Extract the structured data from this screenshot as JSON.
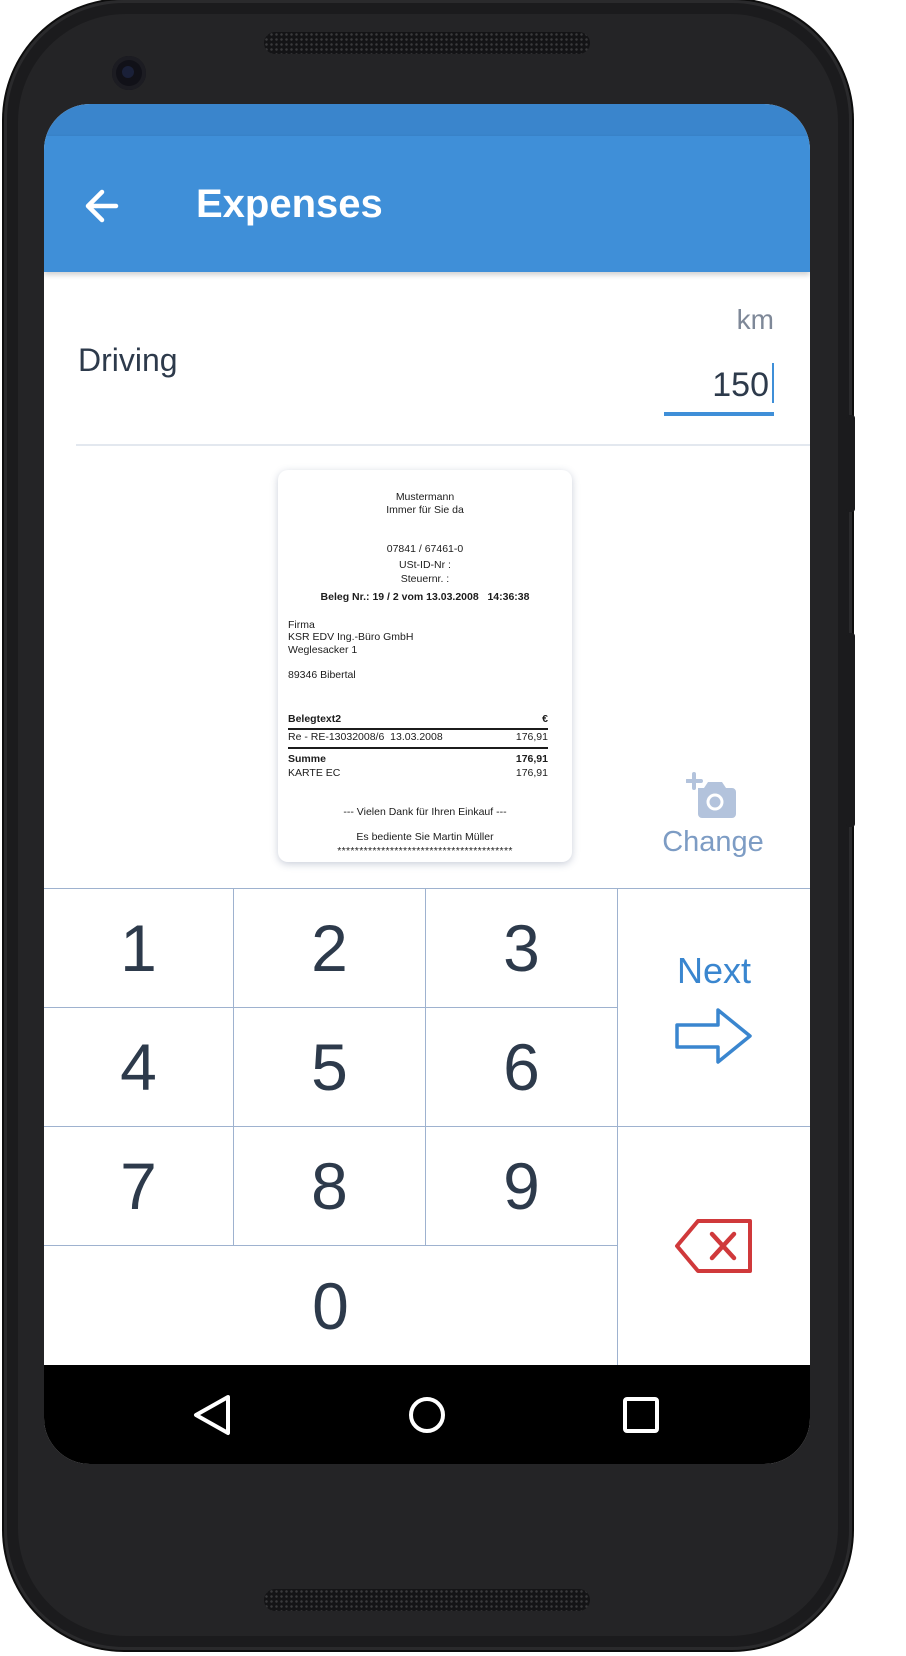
{
  "appbar": {
    "title": "Expenses",
    "back_icon": "arrow-left-icon"
  },
  "entry": {
    "label": "Driving",
    "unit": "km",
    "value": "150"
  },
  "receipt": {
    "shop_name": "Mustermann",
    "slogan": "Immer für Sie da",
    "phone": "07841 / 67461-0",
    "ust_id": "USt-ID-Nr :",
    "tax_no": "Steuernr. :",
    "beleg_line": "Beleg Nr.: 19 / 2 vom 13.03.2008   14:36:38",
    "customer": [
      "Firma",
      "KSR EDV Ing.-Büro GmbH",
      "Weglesacker 1"
    ],
    "city": "89346 Bibertal",
    "table_header": {
      "label": "Belegtext2",
      "currency": "€"
    },
    "row": {
      "label": "Re - RE-13032008/6  13.03.2008",
      "amount": "176,91"
    },
    "sum": {
      "label": "Summe",
      "amount": "176,91"
    },
    "payment": {
      "label": "KARTE EC",
      "amount": "176,91"
    },
    "thanks": "--- Vielen Dank für Ihren Einkauf ---",
    "served_by": "Es bediente Sie Martin Müller",
    "stars": "****************************************"
  },
  "change_button": {
    "label": "Change",
    "icon": "add-photo-icon"
  },
  "keypad": {
    "digits": [
      "1",
      "2",
      "3",
      "4",
      "5",
      "6",
      "7",
      "8",
      "9",
      "0"
    ],
    "next_label": "Next",
    "next_icon": "arrow-right-icon",
    "delete_icon": "backspace-icon"
  },
  "navbar": {
    "icons": [
      "nav-back-icon",
      "nav-home-icon",
      "nav-recents-icon"
    ]
  },
  "colors": {
    "primary": "#3f8fd8",
    "status_bar": "#3a85cc",
    "text": "#2d3a4b",
    "grid": "#9eb2cf",
    "delete": "#d0393b"
  }
}
